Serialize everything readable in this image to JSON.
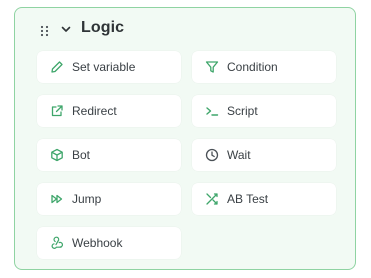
{
  "group": {
    "title": "Logic",
    "drag_icon": "grip-dots-icon",
    "collapse_icon": "chevron-down-icon"
  },
  "blocks": [
    {
      "label": "Set variable",
      "icon": "pencil-icon"
    },
    {
      "label": "Condition",
      "icon": "filter-icon"
    },
    {
      "label": "Redirect",
      "icon": "external-link-icon"
    },
    {
      "label": "Script",
      "icon": "terminal-icon"
    },
    {
      "label": "Bot",
      "icon": "cube-icon"
    },
    {
      "label": "Wait",
      "icon": "clock-icon"
    },
    {
      "label": "Jump",
      "icon": "fast-forward-icon"
    },
    {
      "label": "AB Test",
      "icon": "shuffle-icon"
    },
    {
      "label": "Webhook",
      "icon": "webhook-icon"
    }
  ],
  "colors": {
    "panel_border": "#8fd3a2",
    "panel_background": "#f2faf4",
    "icon_color": "#3fa66b",
    "text_color": "#3a4045"
  }
}
